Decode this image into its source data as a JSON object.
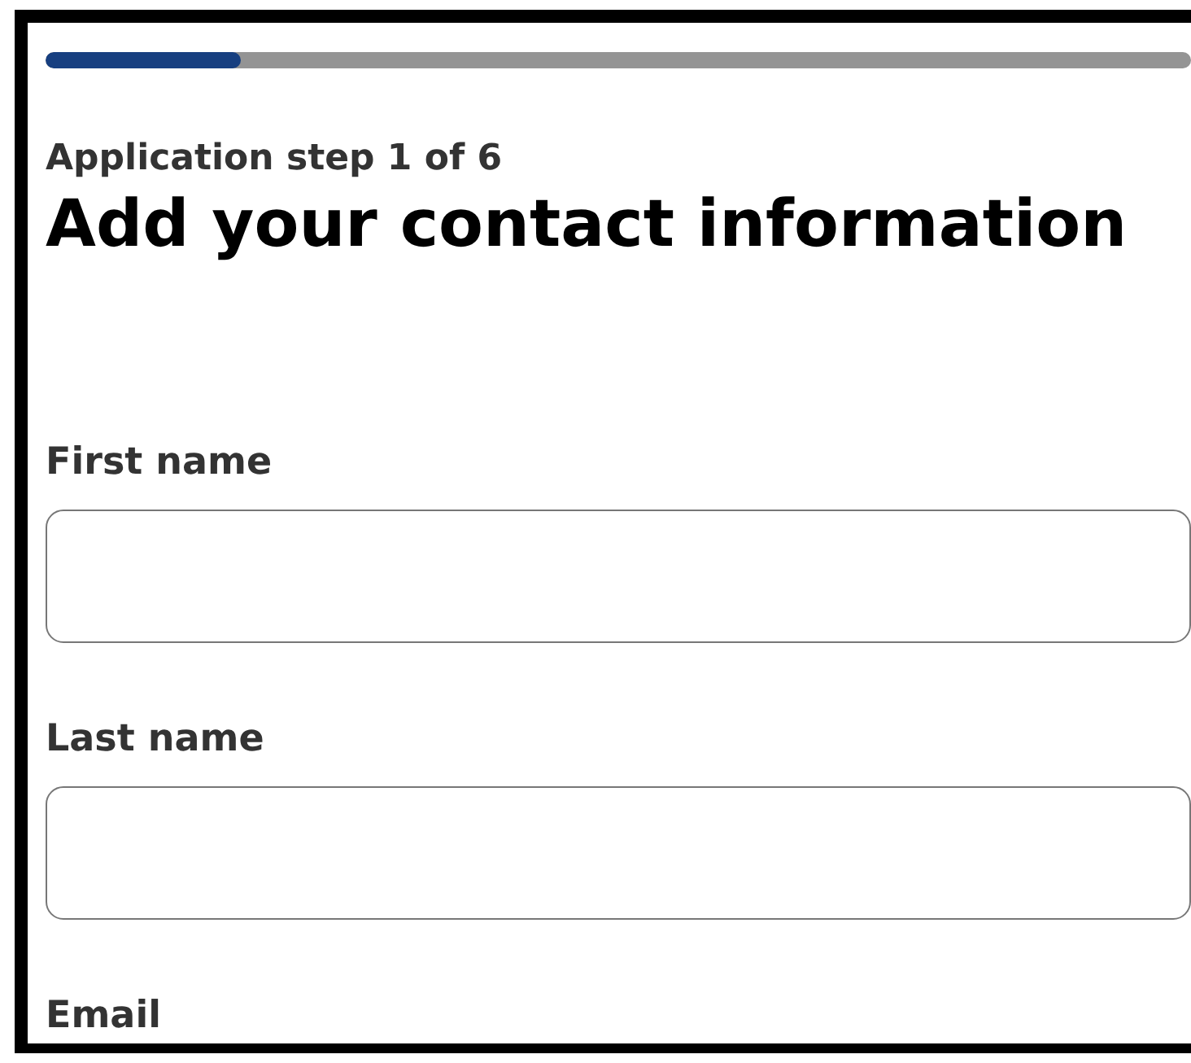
{
  "progress": {
    "level": 0.17
  },
  "step_label": "Application step 1 of 6",
  "heading": "Add your contact information",
  "fields": [
    {
      "label": "First name"
    },
    {
      "label": "Last name"
    },
    {
      "label": "Email"
    }
  ]
}
